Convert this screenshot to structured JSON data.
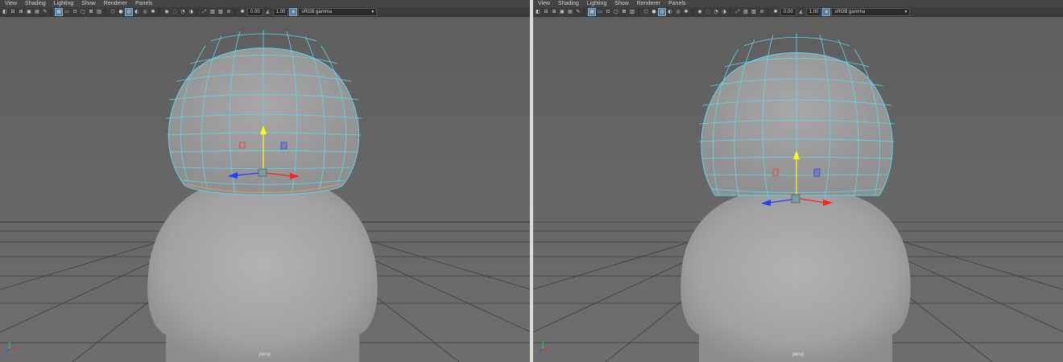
{
  "menu": [
    "View",
    "Shading",
    "Lighting",
    "Show",
    "Renderer",
    "Panels"
  ],
  "toolbar": {
    "exposure_value": "0.00",
    "gamma_value": "1.00",
    "color_space": "sRGB gamma",
    "icons_group1": [
      "select-camera-icon",
      "camera-attributes-icon",
      "bookmarks-icon",
      "image-plane-icon",
      "2d-pan-zoom-icon",
      "grease-pencil-icon"
    ],
    "icons_group2": [
      "grid-icon",
      "film-gate-icon",
      "resolution-gate-icon",
      "gate-mask-icon",
      "field-chart-icon",
      "safe-action-icon"
    ],
    "icons_group3": [
      "wireframe-icon",
      "smooth-shade-icon",
      "wireframe-on-shaded-icon",
      "textured-icon",
      "use-all-lights-icon",
      "shadows-icon"
    ],
    "icons_group4": [
      "screen-space-ao-icon",
      "motion-blur-icon",
      "anti-aliasing-icon",
      "depth-of-field-icon"
    ],
    "icons_group5": [
      "isolate-select-icon",
      "xray-icon",
      "xray-joints-icon",
      "backface-culling-icon"
    ],
    "icons_group6": [
      "exposure-icon",
      "gamma-icon",
      "color-management-icon"
    ]
  },
  "panels": [
    {
      "name": "left-viewport",
      "camera": "persp"
    },
    {
      "name": "right-viewport",
      "camera": "persp"
    }
  ],
  "colors": {
    "viewport_bg": "#6b6b6b",
    "wireframe": "#5fd6e8",
    "gizmo_y": "#ffff00",
    "gizmo_x": "#ff2020",
    "gizmo_z": "#2040ff"
  }
}
